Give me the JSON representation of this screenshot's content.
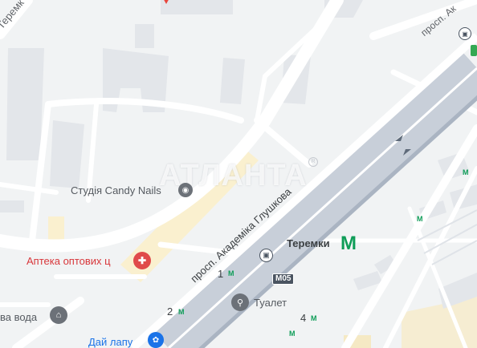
{
  "watermark": "АТЛАНТА",
  "streets": {
    "top_left": "Теремк",
    "avenue_top": "просп. Ак",
    "avenue_center": "просп. Академіка Глушкова"
  },
  "pois": {
    "candy_nails": "Студія Candy Nails",
    "pharmacy": "Аптека оптових ц",
    "water": "ва вода",
    "toilet": "Туалет",
    "dai_lapu": "Дай лапу"
  },
  "metro": {
    "station": "Теремки",
    "symbol": "M"
  },
  "road_shield": "M05",
  "exits": [
    "1",
    "2",
    "4"
  ],
  "colors": {
    "background": "#f1f3f4",
    "road": "#ffffff",
    "highway": "#aab4c2",
    "building": "#e3e6ea",
    "sand": "#faf0cf",
    "metro_green": "#0f9d58",
    "shop_red": "#e04a4a",
    "poi_gray": "#6c7178",
    "poi_blue": "#1a73e8",
    "pharmacy_red": "#d8373b"
  }
}
